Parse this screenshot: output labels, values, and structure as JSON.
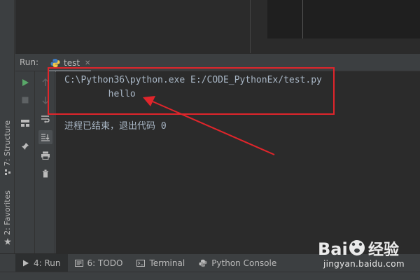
{
  "run_panel": {
    "title": "Run:",
    "tab_label": "test"
  },
  "console": {
    "command_line": "C:\\Python36\\python.exe E:/CODE_PythonEx/test.py",
    "output_line": "        hello",
    "exit_line": "进程已结束，退出代码 0"
  },
  "left_strip": {
    "structure_label": "7: Structure",
    "favorites_label": "2: Favorites"
  },
  "bottom_tabs": [
    {
      "label": "4: Run",
      "icon": "play-icon",
      "active": true
    },
    {
      "label": "6: TODO",
      "icon": "list-icon",
      "active": false
    },
    {
      "label": "Terminal",
      "icon": "terminal-icon",
      "active": false
    },
    {
      "label": "Python Console",
      "icon": "python-icon",
      "active": false
    }
  ],
  "watermark": {
    "brand": "Bai经验",
    "url": "jingyan.baidu.com"
  },
  "colors": {
    "annotation_red": "#e0252b",
    "console_bg": "#2b2b2b",
    "run_green": "#59a869"
  }
}
